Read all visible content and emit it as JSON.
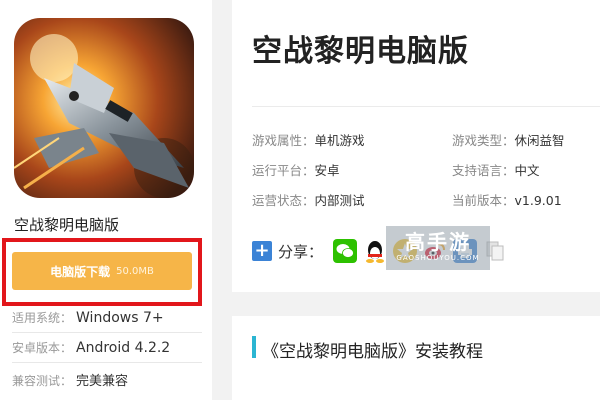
{
  "app": {
    "name": "空战黎明电脑版",
    "title": "空战黎明电脑版"
  },
  "download": {
    "label": "电脑版下载",
    "size": "50.0MB"
  },
  "left_info": [
    {
      "label": "适用系统：",
      "value": "Windows 7+"
    },
    {
      "label": "安卓版本：",
      "value": "Android 4.2.2"
    },
    {
      "label": "兼容测试：",
      "value": "完美兼容"
    }
  ],
  "attributes": [
    {
      "label": "游戏属性：",
      "value": "单机游戏"
    },
    {
      "label": "游戏类型：",
      "value": "休闲益智"
    },
    {
      "label": "运行平台：",
      "value": "安卓"
    },
    {
      "label": "支持语言：",
      "value": "中文"
    },
    {
      "label": "运营状态：",
      "value": "内部测试"
    },
    {
      "label": "当前版本：",
      "value": "v1.9.01"
    }
  ],
  "share": {
    "plus": "+",
    "label": "分享：",
    "icons": [
      "wechat-icon",
      "qq-icon",
      "qzone-icon",
      "weibo-icon",
      "print-icon",
      "copy-icon"
    ]
  },
  "watermark": {
    "text": "高手游",
    "url": "GAOSHOUYOU.COM"
  },
  "section": {
    "title": "《空战黎明电脑版》安装教程"
  },
  "colors": {
    "download_button": "#f6b548",
    "highlight_border": "#e2161b",
    "section_accent": "#2bb5d2",
    "share_blue": "#3b83d6",
    "wechat_green": "#2dc100"
  }
}
